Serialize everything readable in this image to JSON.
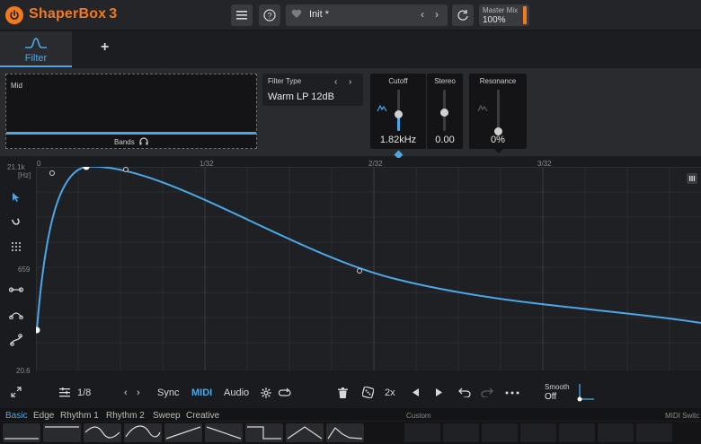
{
  "app": {
    "brand": "ShaperBox",
    "version": "3"
  },
  "topbar": {
    "preset_name": "Init *",
    "prev_arrow": "‹",
    "next_arrow": "›",
    "master_mix_label": "Master Mix",
    "master_mix_value": "100%",
    "accent": "#f07a1e"
  },
  "tabs": {
    "active": "Filter",
    "add": "+"
  },
  "panel": {
    "band_name": "Mid",
    "bands_label": "Bands",
    "filter_type_label": "Filter Type",
    "filter_type_value": "Warm LP 12dB",
    "cutoff": {
      "label": "Cutoff",
      "value": "1.82kHz",
      "level": 0.45
    },
    "stereo": {
      "label": "Stereo",
      "value": "0.00",
      "level": 0.5
    },
    "resonance": {
      "label": "Resonance",
      "value": "0%",
      "level": 0.0
    }
  },
  "graph": {
    "y_labels": {
      "top": "21.1k",
      "unit": "[Hz]",
      "mid": "659",
      "bottom": "20.6"
    },
    "x_labels": [
      "0",
      "1/32",
      "2/32",
      "3/32"
    ],
    "curve_color": "#4aa8e8"
  },
  "toolbar": {
    "grid": "1/8",
    "prev": "‹",
    "next": "›",
    "sync": "Sync",
    "midi": "MIDI",
    "audio": "Audio",
    "multiplier": "2x",
    "smooth_label": "Smooth",
    "smooth_value": "Off"
  },
  "shape_tabs": [
    "Basic",
    "Edge",
    "Rhythm 1",
    "Rhythm 2",
    "Sweep",
    "Creative"
  ],
  "shape_library": {
    "custom_label": "Custom",
    "midi_switch_label": "MIDI Switc"
  }
}
